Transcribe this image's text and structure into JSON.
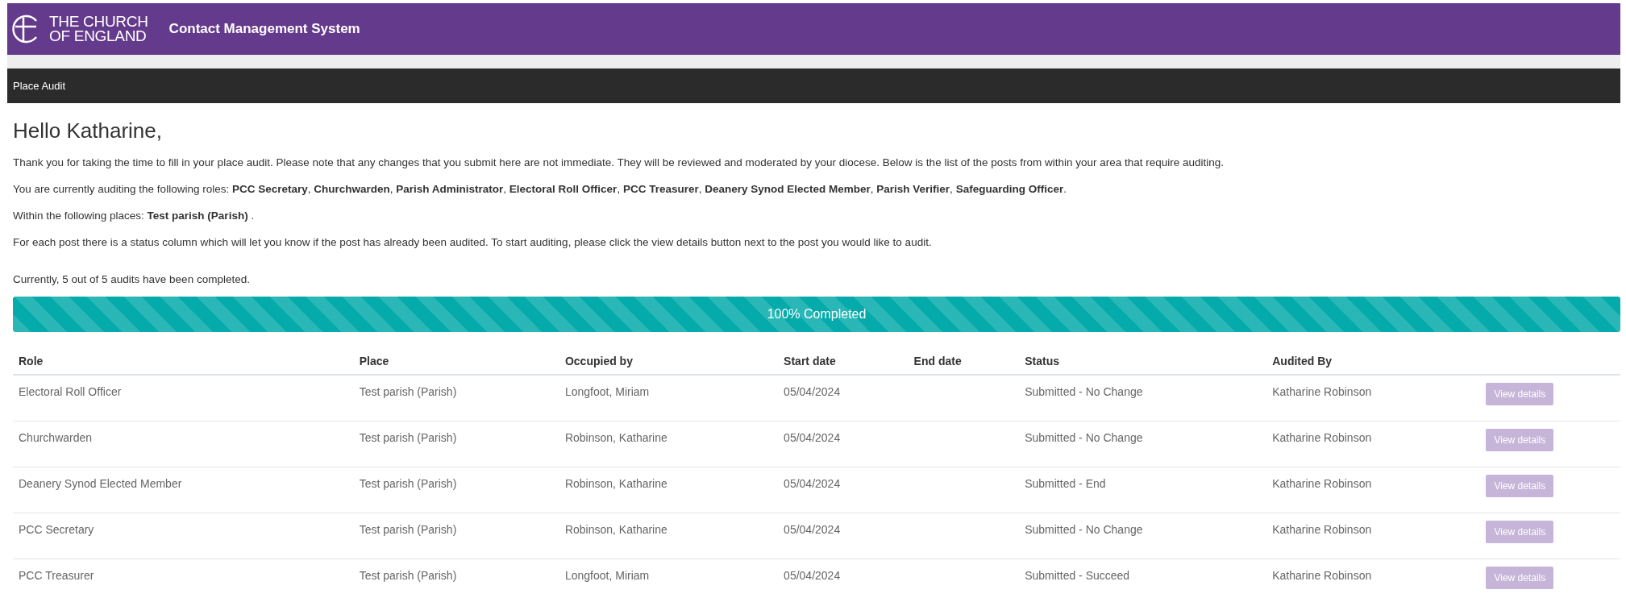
{
  "header": {
    "logo_lines": [
      "THE CHURCH",
      "OF ENGLAND"
    ],
    "title": "Contact Management System"
  },
  "nav": {
    "items": [
      {
        "label": "Place Audit"
      }
    ]
  },
  "greeting": "Hello Katharine,",
  "paragraphs": [
    "Thank you for taking the time to fill in your place audit. Please note that any changes that you submit here are not immediate. They will be reviewed and moderated by your diocese. Below is the list of the posts from within your area that require auditing.",
    "You are currently auditing the following roles: **PCC Secretary**, **Churchwarden**, **Parish Administrator**, **Electoral Roll Officer**, **PCC Treasurer**, **Deanery Synod Elected Member**, **Parish Verifier**, **Safeguarding Officer**.",
    "Within the following places: **Test parish (Parish)** .",
    "For each post there is a status column which will let you know if the post has already been audited. To start auditing, please click the view details button next to the post you would like to audit."
  ],
  "summary": "Currently, 5 out of 5 audits have been completed.",
  "progress": {
    "level": 1,
    "label": "100% Completed"
  },
  "table": {
    "columns": [
      "Role",
      "Place",
      "Occupied by",
      "Start date",
      "End date",
      "Status",
      "Audited By"
    ],
    "rows": [
      {
        "cells": [
          "Electoral Roll Officer",
          "Test parish (Parish)",
          "Longfoot, Miriam",
          "05/04/2024",
          "",
          "Submitted - No Change",
          "Katharine Robinson"
        ],
        "button": {
          "label": "View details",
          "disabled": true
        }
      },
      {
        "cells": [
          "Churchwarden",
          "Test parish (Parish)",
          "Robinson, Katharine",
          "05/04/2024",
          "",
          "Submitted - No Change",
          "Katharine Robinson"
        ],
        "button": {
          "label": "View details",
          "disabled": true
        }
      },
      {
        "cells": [
          "Deanery Synod Elected Member",
          "Test parish (Parish)",
          "Robinson, Katharine",
          "05/04/2024",
          "",
          "Submitted - End",
          "Katharine Robinson"
        ],
        "button": {
          "label": "View details",
          "disabled": true
        }
      },
      {
        "cells": [
          "PCC Secretary",
          "Test parish (Parish)",
          "Robinson, Katharine",
          "05/04/2024",
          "",
          "Submitted - No Change",
          "Katharine Robinson"
        ],
        "button": {
          "label": "View details",
          "disabled": true
        }
      },
      {
        "cells": [
          "PCC Treasurer",
          "Test parish (Parish)",
          "Longfoot, Miriam",
          "05/04/2024",
          "",
          "Submitted - Succeed",
          "Katharine Robinson"
        ],
        "button": {
          "label": "View details",
          "disabled": true
        }
      }
    ]
  }
}
